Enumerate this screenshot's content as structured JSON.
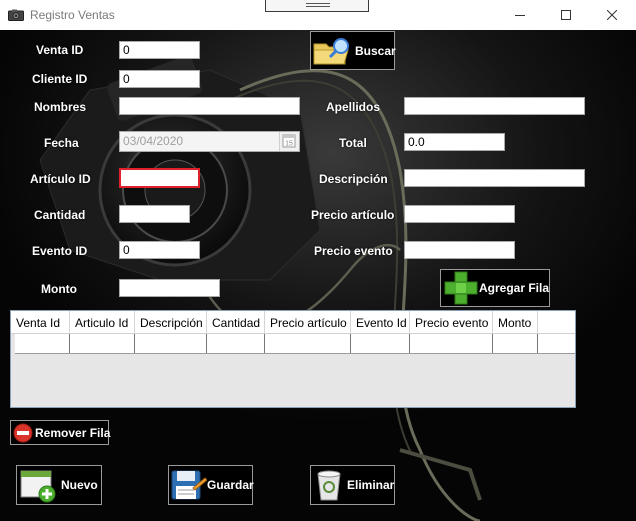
{
  "window": {
    "title": "Registro Ventas",
    "icon": "camera-icon"
  },
  "form": {
    "venta_id_label": "Venta ID",
    "venta_id_value": "0",
    "cliente_id_label": "Cliente ID",
    "cliente_id_value": "0",
    "nombres_label": "Nombres",
    "nombres_value": "",
    "apellidos_label": "Apellidos",
    "apellidos_value": "",
    "fecha_label": "Fecha",
    "fecha_value": "03/04/2020",
    "fecha_btn": "15",
    "total_label": "Total",
    "total_value": "0.0",
    "articulo_id_label": "Artículo ID",
    "articulo_id_value": "",
    "descripcion_label": "Descripción",
    "descripcion_value": "",
    "cantidad_label": "Cantidad",
    "cantidad_value": "",
    "precio_articulo_label": "Precio artículo",
    "precio_articulo_value": "",
    "evento_id_label": "Evento ID",
    "evento_id_value": "0",
    "precio_evento_label": "Precio evento",
    "precio_evento_value": "",
    "monto_label": "Monto",
    "monto_value": ""
  },
  "buttons": {
    "buscar": "Buscar",
    "agregar_fila": "Agregar Fila",
    "remover_fila": "Remover Fila",
    "nuevo": "Nuevo",
    "guardar": "Guardar",
    "eliminar": "Eliminar"
  },
  "grid": {
    "columns": [
      "Venta Id",
      "Articulo Id",
      "Descripción",
      "Cantidad",
      "Precio artículo",
      "Evento Id",
      "Precio evento",
      "Monto"
    ]
  },
  "colors": {
    "background": "#050505",
    "label": "#ffffff",
    "error_border": "#e0202a",
    "grid_border": "#8aa0b5"
  }
}
